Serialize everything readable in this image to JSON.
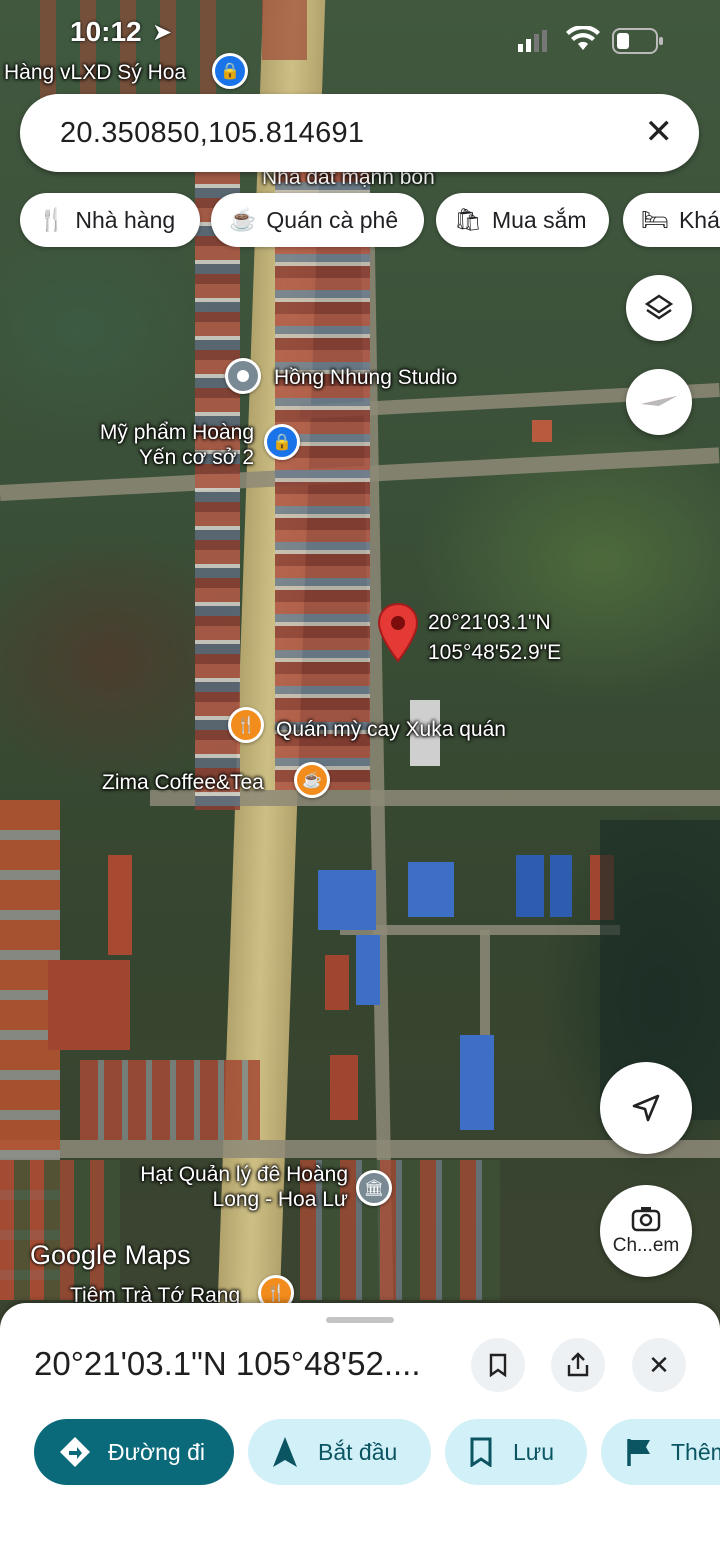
{
  "status_bar": {
    "time": "10:12"
  },
  "search": {
    "query": "20.350850,105.814691"
  },
  "chips": [
    {
      "label": "Nhà hàng",
      "icon": "restaurant-icon"
    },
    {
      "label": "Quán cà phê",
      "icon": "coffee-icon"
    },
    {
      "label": "Mua sắm",
      "icon": "shopping-bag-icon"
    },
    {
      "label": "Khác",
      "icon": "bed-icon"
    }
  ],
  "map": {
    "places": [
      {
        "name": "Hàng vLXD Sý Hoa",
        "type": "shopping"
      },
      {
        "name": "Nhà đất mạnh bốn",
        "type": "place"
      },
      {
        "name": "Hồng Nhung Studio",
        "type": "place"
      },
      {
        "name": "Mỹ phẩm Hoàng Yến cơ sở 2",
        "type": "shopping"
      },
      {
        "name": "Quán mỳ cay Xuka quán",
        "type": "restaurant"
      },
      {
        "name": "Zima Coffee&Tea",
        "type": "coffee"
      },
      {
        "name": "Hạt Quản lý đê Hoàng Long - Hoa Lư",
        "type": "government"
      },
      {
        "name": "Tiệm Trà Tớ Rang",
        "type": "restaurant"
      }
    ],
    "pin_label": {
      "lat": "20°21'03.1\"N",
      "lng": "105°48'52.9\"E"
    },
    "attribution": "Google Maps",
    "camera_label": "Ch...em"
  },
  "sheet": {
    "title": "20°21'03.1\"N 105°48'52....",
    "actions": [
      {
        "label": "Đường đi",
        "icon": "directions-icon"
      },
      {
        "label": "Bắt đầu",
        "icon": "navigation-arrow-icon"
      },
      {
        "label": "Lưu",
        "icon": "bookmark-icon"
      },
      {
        "label": "Thêm",
        "icon": "flag-icon"
      }
    ]
  },
  "colors": {
    "primary": "#0b6a7a",
    "secondary_bg": "#d2f0f7",
    "pin": "#e53935",
    "restaurant_marker": "#f28c1d",
    "shopping_marker": "#1a73e8"
  }
}
